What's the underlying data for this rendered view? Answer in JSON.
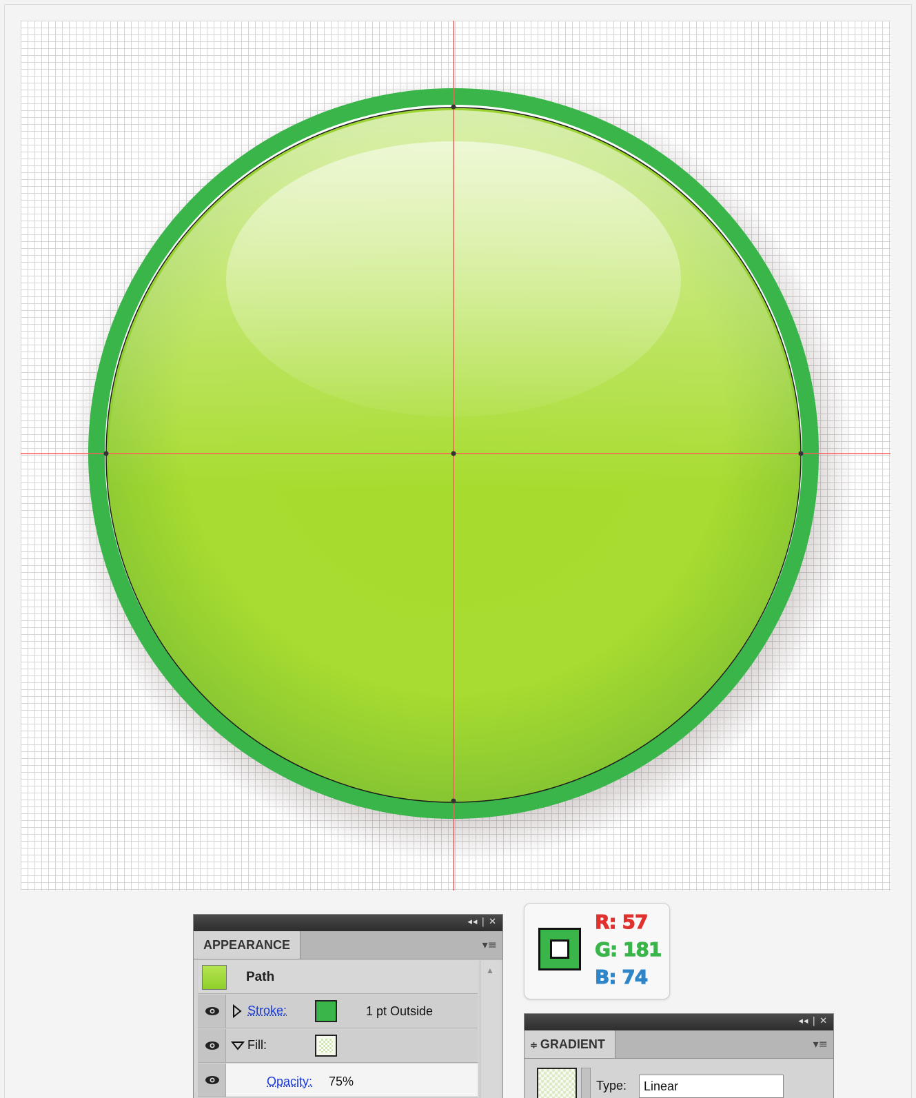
{
  "colors": {
    "ring": "#39b54a",
    "ball_light": "#b5e552",
    "ball_mid": "#a6dc2e",
    "ball_edge": "#7dbf33",
    "guide": "#ff5a5a",
    "r_color": "#e0312f",
    "g_color": "#39b54a",
    "b_color": "#2e86c9"
  },
  "appearance_panel": {
    "title": "APPEARANCE",
    "window_controls": "◂◂ | ✕",
    "menu_icon": "menu-icon",
    "object_label": "Path",
    "stroke": {
      "label": "Stroke:",
      "value": "1 pt  Outside"
    },
    "fill": {
      "label": "Fill:"
    },
    "opacity": {
      "label": "Opacity:",
      "value": "75%"
    }
  },
  "rgb": {
    "r": "R: 57",
    "g": "G: 181",
    "b": "B: 74"
  },
  "gradient_panel": {
    "title": "GRADIENT",
    "type_label": "Type:",
    "type_value": "Linear",
    "window_controls": "◂◂ | ✕"
  }
}
